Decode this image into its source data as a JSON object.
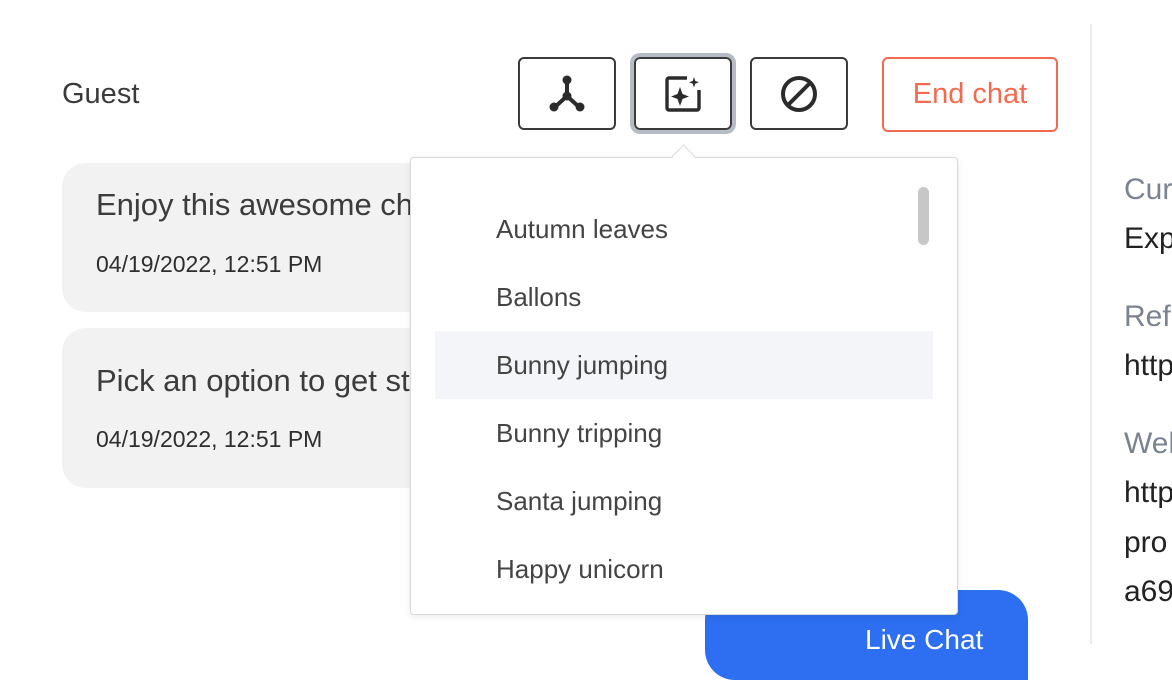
{
  "header": {
    "title": "Guest",
    "end_chat_label": "End chat"
  },
  "toolbar": {
    "icons": [
      "transfer-icon",
      "effects-icon",
      "block-icon"
    ]
  },
  "messages": [
    {
      "text": "Enjoy this awesome ch",
      "timestamp": "04/19/2022, 12:51 PM"
    },
    {
      "text": "Pick an option to get st",
      "timestamp": "04/19/2022, 12:51 PM"
    }
  ],
  "live_chat": {
    "label": "Live Chat"
  },
  "effects_menu": {
    "items": [
      "Autumn leaves",
      "Ballons",
      "Bunny jumping",
      "Bunny tripping",
      "Santa jumping",
      "Happy unicorn"
    ],
    "highlighted": "Bunny jumping"
  },
  "side_panel": {
    "label1": "Cur",
    "value1": "Exp",
    "label2": "Ref",
    "value2": "http",
    "label3": "Wel",
    "value3a": "http",
    "value3b": "pro",
    "value3c": "a69"
  },
  "colors": {
    "accent": "#2d6ff0",
    "danger": "#f26a4f"
  }
}
